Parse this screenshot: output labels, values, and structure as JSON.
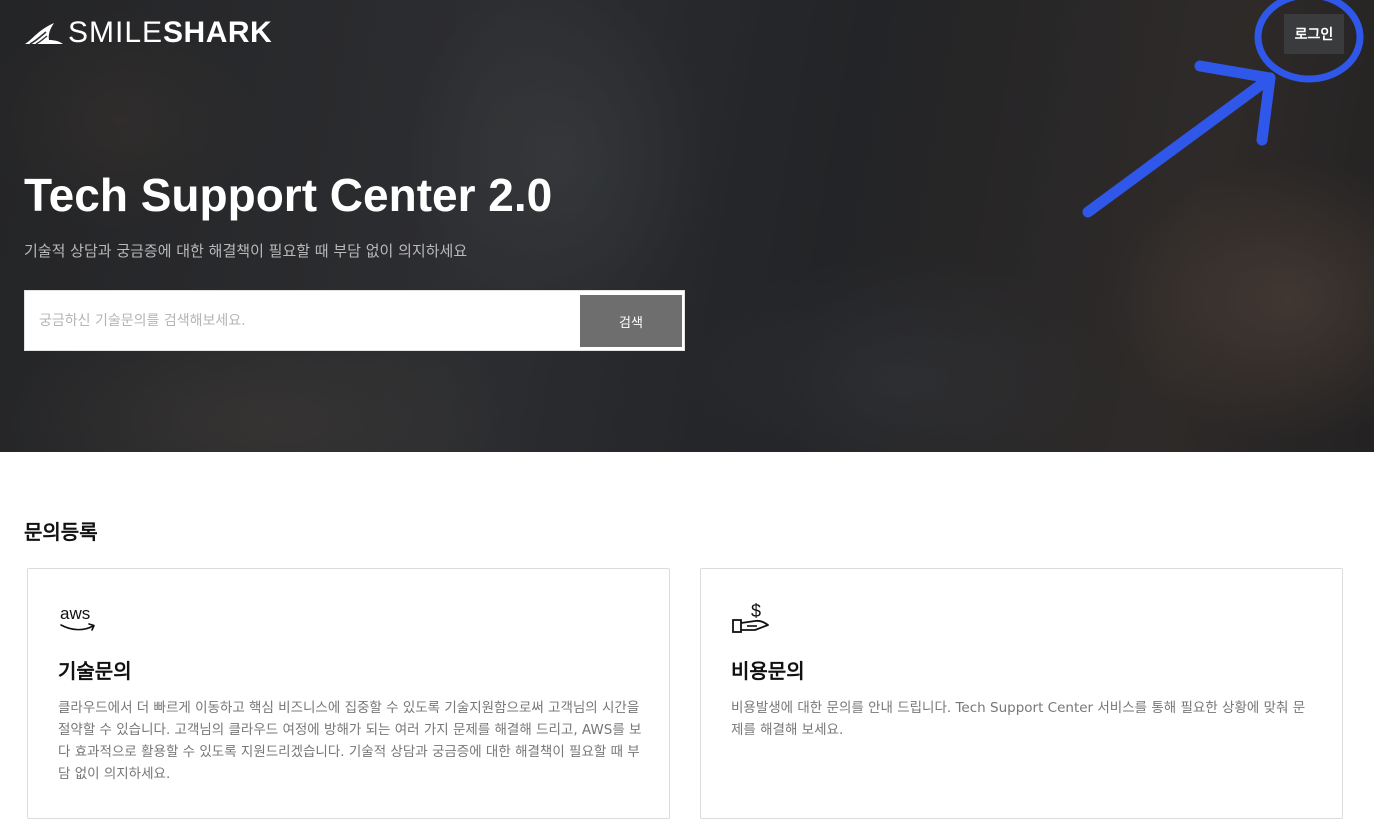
{
  "header": {
    "logo_text_thin": "SMILE",
    "logo_text_bold": "SHARK",
    "login_label": "로그인"
  },
  "hero": {
    "title": "Tech Support Center 2.0",
    "subtitle": "기술적 상담과 궁금증에 대한 해결책이 필요할 때 부담 없이 의지하세요",
    "search": {
      "placeholder": "궁금하신 기술문의를 검색해보세요.",
      "value": "",
      "button_label": "검색"
    }
  },
  "inquiry": {
    "section_title": "문의등록",
    "cards": [
      {
        "icon": "aws-icon",
        "title": "기술문의",
        "description": "클라우드에서 더 빠르게 이동하고 핵심 비즈니스에 집중할 수 있도록 기술지원함으로써 고객님의 시간을 절약할 수 있습니다. 고객님의 클라우드 여정에 방해가 되는 여러 가지 문제를 해결해 드리고, AWS를 보다 효과적으로 활용할 수 있도록 지원드리겠습니다. 기술적 상담과 궁금증에 대한 해결책이 필요할 때 부담 없이 의지하세요."
      },
      {
        "icon": "money-hand-icon",
        "title": "비용문의",
        "description": "비용발생에 대한 문의를 안내 드립니다. Tech Support Center 서비스를 통해 필요한 상황에 맞춰 문제를 해결해 보세요."
      }
    ]
  },
  "colors": {
    "annotation": "#2f57ea",
    "search_button": "#6e6e6e",
    "login_button": "#3a3b3d"
  }
}
